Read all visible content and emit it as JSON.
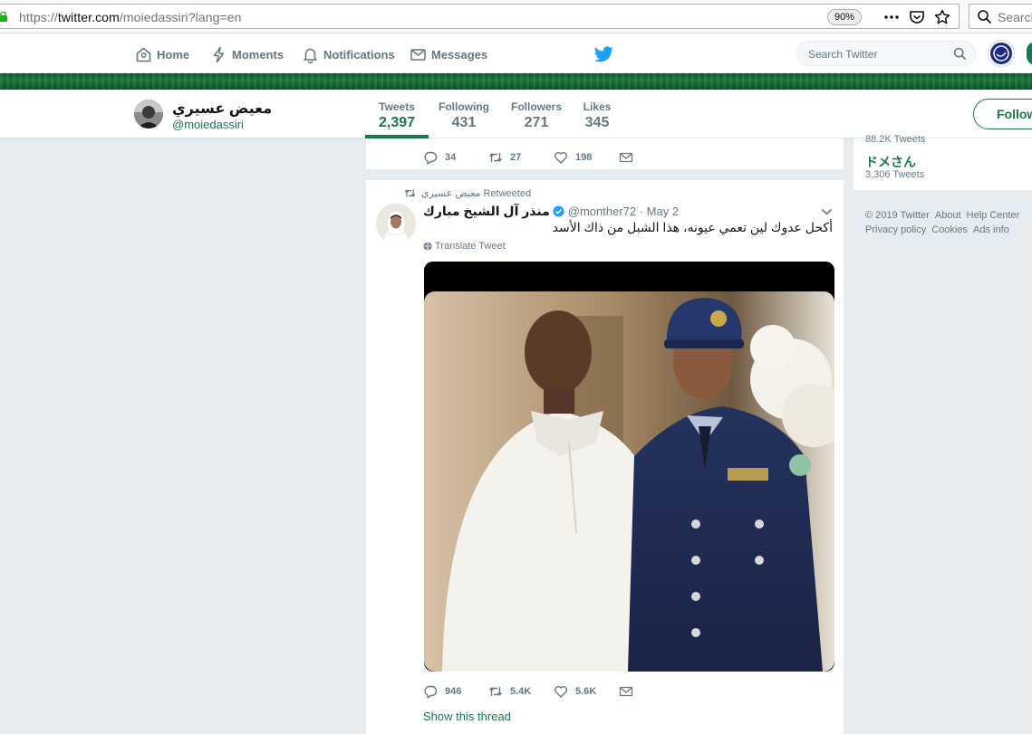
{
  "browser": {
    "url_prefix": "https://",
    "url_host": "twitter.com",
    "url_path": "/moiedassiri?lang=en",
    "zoom": "90%",
    "search_placeholder": "Search"
  },
  "topnav": {
    "home": "Home",
    "moments": "Moments",
    "notifications": "Notifications",
    "messages": "Messages",
    "search_placeholder": "Search Twitter"
  },
  "profile": {
    "name": "معيض عسيري",
    "handle": "@moiedassiri",
    "follow_label": "Follow"
  },
  "stats": [
    {
      "label": "Tweets",
      "value": "2,397"
    },
    {
      "label": "Following",
      "value": "431"
    },
    {
      "label": "Followers",
      "value": "271"
    },
    {
      "label": "Likes",
      "value": "345"
    }
  ],
  "prev_tweet": {
    "replies": "34",
    "retweets": "27",
    "likes": "198"
  },
  "tweet": {
    "retweeted_by": "معيض عسيري Retweeted",
    "author_name": "منذر آل الشيخ مبارك",
    "author_handle": "@monther72 · May 2",
    "text": "أكحل عدوك لين تعمي عيونه، هذا الشبل من ذاك الأسد",
    "translate_label": "Translate Tweet",
    "replies": "946",
    "retweets": "5.4K",
    "likes": "5.6K",
    "show_thread": "Show this thread"
  },
  "sidebar": {
    "cut_text": "88.2K Tweets",
    "trend_name": "ドメさん",
    "trend_count": "3,306 Tweets",
    "footer": [
      "© 2019 Twitter",
      "About",
      "Help Center",
      "Privacy policy",
      "Cookies",
      "Ads info"
    ]
  },
  "colors": {
    "accent": "#17794a",
    "meta_text": "#657786",
    "background": "#e6ecf0"
  }
}
